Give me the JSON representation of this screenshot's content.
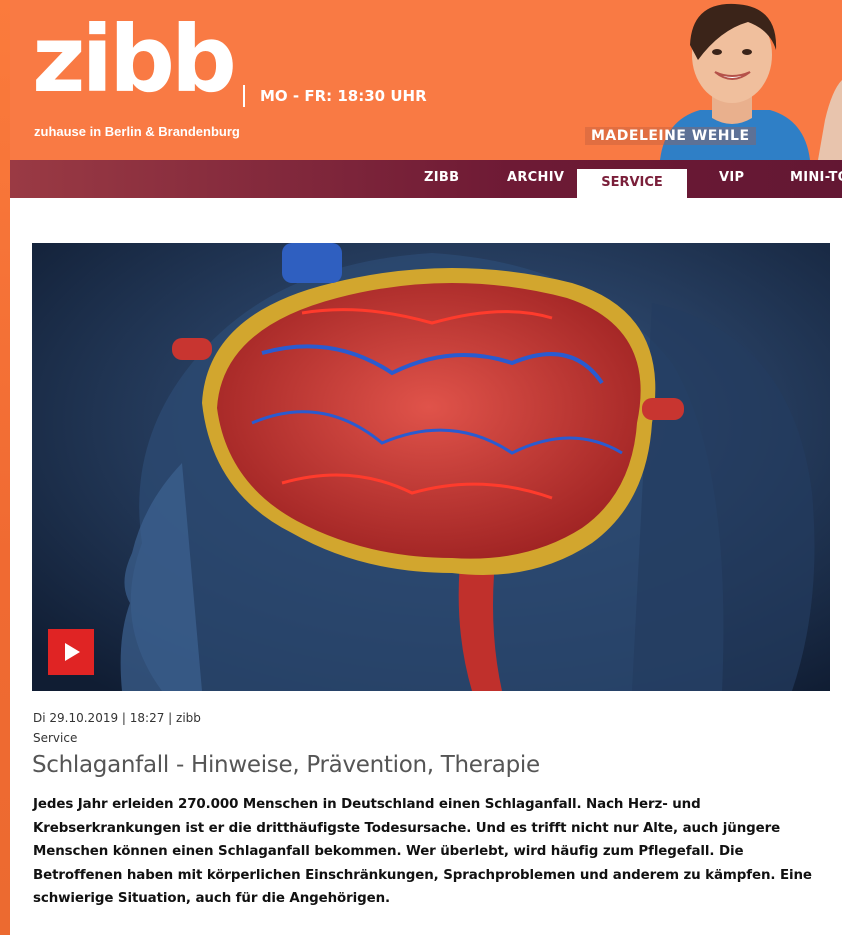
{
  "header": {
    "logo": "zibb",
    "logo_sub": "zuhause in Berlin & Brandenburg",
    "showtime": "MO - FR: 18:30 UHR",
    "presenter_name": "MADELEINE WEHLE",
    "colors": {
      "orange": "#f97a44",
      "nav": "#6e1a35"
    }
  },
  "nav": {
    "items": [
      {
        "label": "ZIBB"
      },
      {
        "label": "ARCHIV"
      },
      {
        "label": "SERVICE",
        "active": true
      },
      {
        "label": "VIP"
      },
      {
        "label": "MINI-TO"
      }
    ]
  },
  "video": {
    "play_icon": "play-icon",
    "play_color": "#e02424"
  },
  "article": {
    "meta": "Di 29.10.2019 | 18:27 | zibb",
    "category": "Service",
    "title": "Schlaganfall - Hinweise, Prävention, Therapie",
    "teaser": "Jedes Jahr erleiden 270.000 Menschen in Deutschland einen Schlaganfall. Nach Herz- und Krebserkrankungen ist er die dritthäufigste Todesursache. Und es trifft nicht nur Alte, auch jüngere Menschen können einen Schlaganfall bekommen. Wer überlebt, wird häufig zum Pflegefall. Die Betroffenen haben mit körperlichen Einschränkungen, Sprachproblemen und anderem zu kämpfen. Eine schwierige Situation, auch für die Angehörigen."
  }
}
